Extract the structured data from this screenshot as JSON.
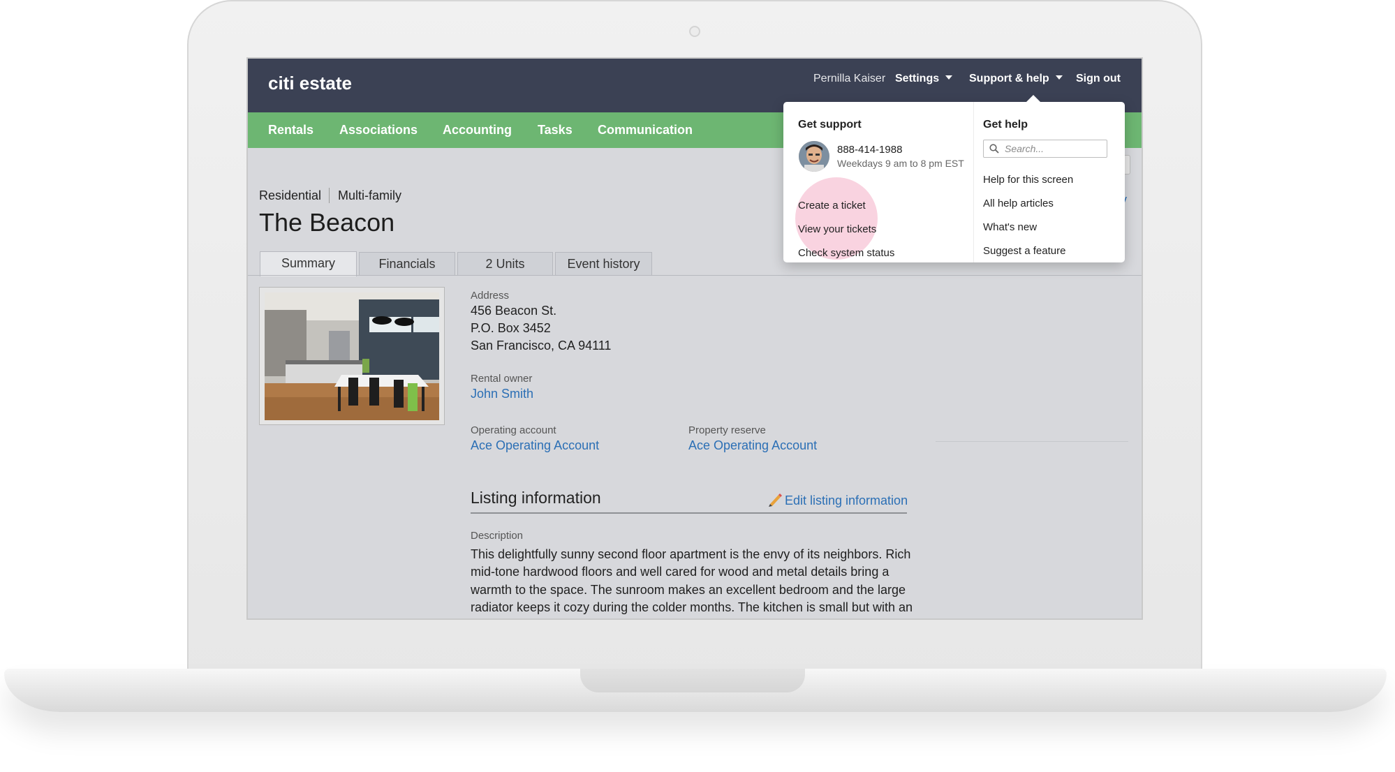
{
  "app": {
    "logo": "citi estate"
  },
  "topbar": {
    "user": "Pernilla Kaiser",
    "settings_label": "Settings",
    "support_label": "Support & help",
    "signout_label": "Sign out"
  },
  "nav": {
    "items": [
      "Rentals",
      "Associations",
      "Accounting",
      "Tasks",
      "Communication"
    ]
  },
  "property": {
    "breadcrumb": [
      "Residential",
      "Multi-family"
    ],
    "title": "The Beacon",
    "tabs": [
      "Summary",
      "Financials",
      "2 Units",
      "Event history"
    ],
    "active_tab": "Summary",
    "address_label": "Address",
    "address_lines": [
      "456 Beacon St.",
      "P.O. Box 3452",
      "San Francisco, CA 94111"
    ],
    "owner_label": "Rental owner",
    "owner": "John Smith",
    "operating_label": "Operating account",
    "operating_value": "Ace Operating Account",
    "reserve_label": "Property reserve",
    "reserve_value": "Ace Operating Account"
  },
  "listing": {
    "title": "Listing information",
    "edit_label": "Edit listing information",
    "description_label": "Description",
    "description": "This delightfully sunny second floor apartment is the envy of its neighbors. Rich mid-tone hardwood floors and well cared for wood and metal details bring a warmth to the space. The sunroom makes an excellent bedroom and the large radiator keeps it cozy during the colder months. The kitchen is small but with an"
  },
  "dropdown": {
    "support_title": "Get support",
    "phone": "888-414-1988",
    "hours": "Weekdays 9 am to 8 pm EST",
    "support_items": [
      "Create a ticket",
      "View your tickets",
      "Check system status"
    ],
    "help_title": "Get help",
    "search_placeholder": "Search...",
    "help_items": [
      "Help for this screen",
      "All help articles",
      "What's new",
      "Suggest a feature"
    ]
  },
  "colors": {
    "topbar": "#3b4154",
    "navbar": "#6db672",
    "link": "#2b6fb5",
    "highlight": "#ee78a0"
  }
}
